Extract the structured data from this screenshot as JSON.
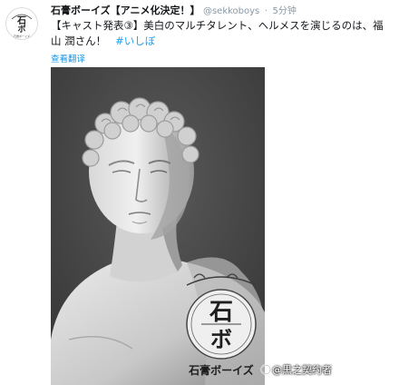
{
  "tweet": {
    "display_name": "石膏ボーイズ【アニメ化決定！】",
    "handle": "@sekkoboys",
    "separator": "·",
    "time": "5分钟",
    "text_line1": "【キャスト発表③】美白のマルチタレント、ヘルメスを演じるのは、福",
    "text_line2": "山 潤さん！",
    "hashtag": "#いしぼ",
    "translate_label": "查看翻译"
  },
  "avatar": {
    "top_text": "石",
    "middle_text": "ボ",
    "caption": "石膏ボーイズ"
  },
  "media": {
    "emblem_top": "石",
    "emblem_bottom": "ボ",
    "caption": "石膏ボーイズ",
    "watermark": "@黒之契约者"
  },
  "colors": {
    "link": "#1da1f2",
    "muted": "#8899a6",
    "photo_bg": "#464646"
  }
}
